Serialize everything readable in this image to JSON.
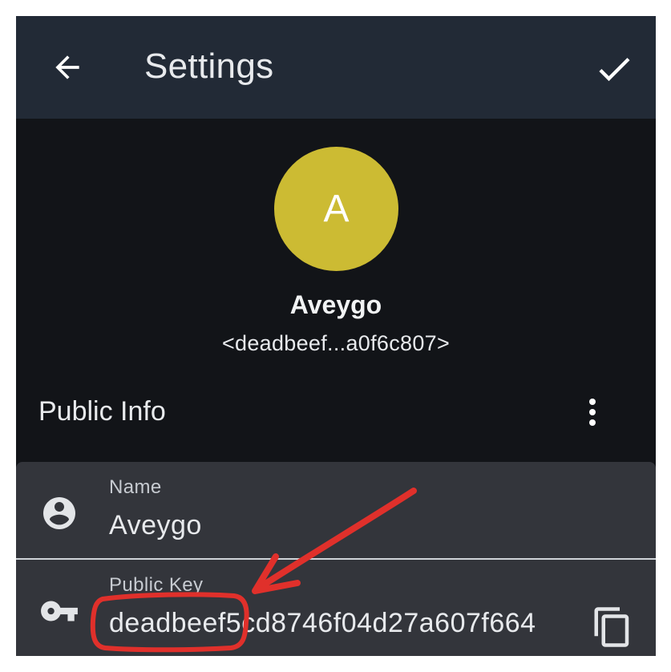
{
  "appbar": {
    "title": "Settings",
    "back_icon": "arrow-back-icon",
    "confirm_icon": "check-icon"
  },
  "profile": {
    "avatar_letter": "A",
    "avatar_color": "#ccbb33",
    "display_name": "Aveygo",
    "short_key": "<deadbeef...a0f6c807>"
  },
  "section": {
    "title": "Public Info",
    "menu_icon": "more-vert-icon"
  },
  "fields": {
    "name": {
      "label": "Name",
      "value": "Aveygo",
      "icon": "account-circle-icon"
    },
    "public_key": {
      "label": "Public Key",
      "value": "deadbeef5cd8746f04d27a607f664",
      "icon": "key-icon",
      "action_icon": "copy-icon"
    }
  },
  "annotation": {
    "color": "#e0302b"
  },
  "colors": {
    "appbar_bg": "#222a36",
    "screen_bg": "#121418",
    "field_bg": "#33353b"
  }
}
